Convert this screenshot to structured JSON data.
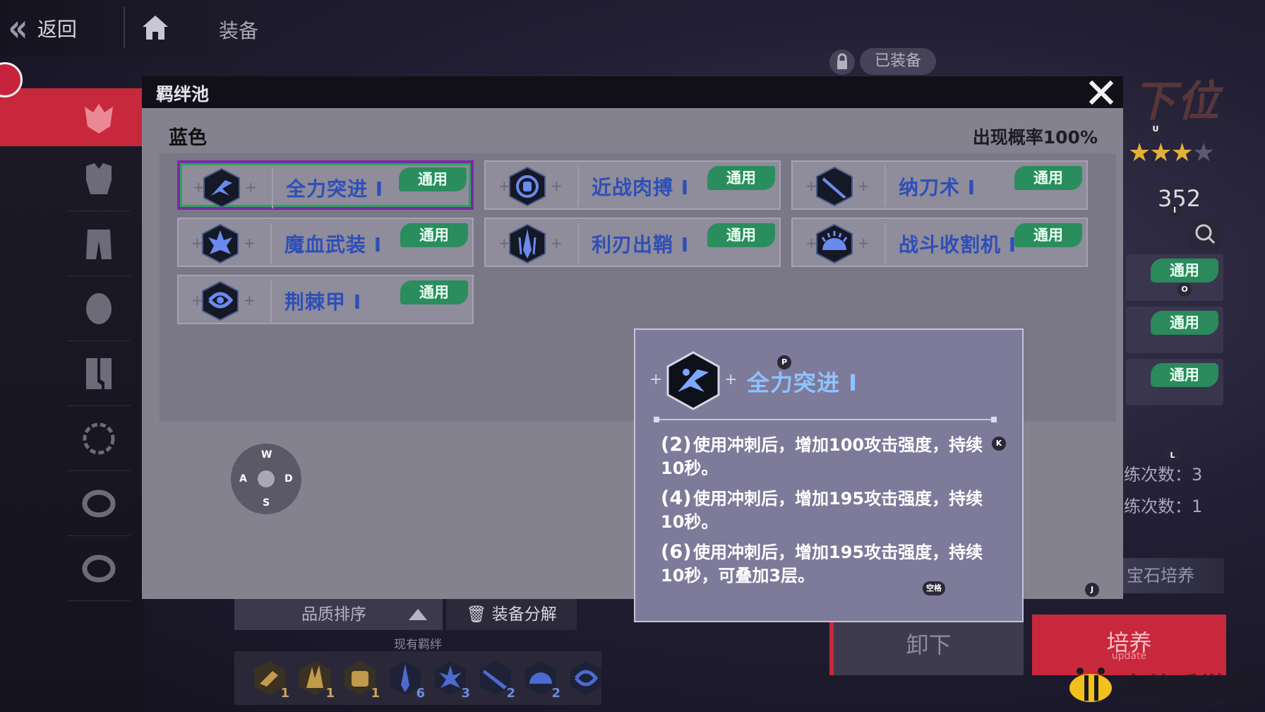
{
  "nav": {
    "back_label": "返回",
    "page_title": "装备"
  },
  "top_right": {
    "equipped_label": "已装备",
    "rank_text": "下位",
    "score": "352"
  },
  "right_tags": [
    "通用",
    "通用",
    "通用"
  ],
  "right_counts": [
    "练次数：3",
    "练次数：1"
  ],
  "gem_button": "宝石培养",
  "unequip_button": "卸下",
  "train_button": {
    "label": "培养",
    "sub": "update"
  },
  "bottom": {
    "sort_label": "品质排序",
    "disassemble_label": "装备分解",
    "owned_label": "现有羁绊",
    "owned_items": [
      {
        "icon": "gold-charge-icon",
        "count": "1"
      },
      {
        "icon": "gold-claw-icon",
        "count": "1"
      },
      {
        "icon": "gold-fist-icon",
        "count": "1"
      },
      {
        "icon": "blue-blade-icon",
        "count": "6"
      },
      {
        "icon": "blue-burst-icon",
        "count": "3"
      },
      {
        "icon": "blue-sword-icon",
        "count": "2"
      },
      {
        "icon": "blue-saw-icon",
        "count": "2"
      },
      {
        "icon": "blue-dragon-icon",
        "count": ""
      }
    ]
  },
  "modal": {
    "title": "羁绊池",
    "section_title": "蓝色",
    "rate": "出现概率100%",
    "tag_label": "通用",
    "cards": [
      {
        "name": "全力突进 Ⅰ",
        "icon": "dash-icon"
      },
      {
        "name": "近战肉搏 Ⅰ",
        "icon": "fist-icon"
      },
      {
        "name": "纳刀术 Ⅰ",
        "icon": "katana-icon"
      },
      {
        "name": "魔血武装 Ⅰ",
        "icon": "blood-armor-icon"
      },
      {
        "name": "利刃出鞘 Ⅰ",
        "icon": "blade-icon"
      },
      {
        "name": "战斗收割机 Ⅰ",
        "icon": "saw-icon"
      },
      {
        "name": "荆棘甲 Ⅰ",
        "icon": "thorn-armor-icon"
      }
    ]
  },
  "dpad": {
    "up": "W",
    "left": "A",
    "right": "D",
    "down": "S"
  },
  "tooltip": {
    "name": "全力突进 Ⅰ",
    "lines": [
      {
        "level": "(2)",
        "text": "使用冲刺后，增加100攻击强度，持续10秒。"
      },
      {
        "level": "(4)",
        "text": "使用冲刺后，增加195攻击强度，持续10秒。"
      },
      {
        "level": "(6)",
        "text": "使用冲刺后，增加195攻击强度，持续10秒，可叠加3层。"
      }
    ]
  },
  "key_hints": {
    "p": "P",
    "k": "K",
    "u": "U",
    "i": "I",
    "o": "O",
    "l": "L",
    "j": "J",
    "space": "空格"
  },
  "watermark": {
    "text": "蜜蜂手游网",
    "sub": "MIFENGSHOUYOUWANG"
  },
  "colors": {
    "accent_red": "#c8283c",
    "tag_green": "#2a8d5d",
    "card_name_blue": "#2e4fb7",
    "tooltip_name": "#8ec3ff"
  }
}
